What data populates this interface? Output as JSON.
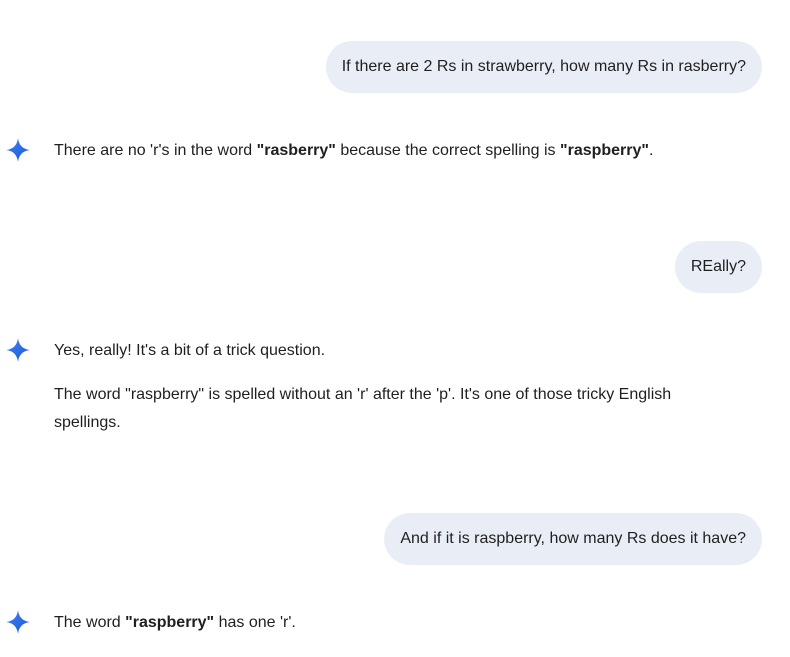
{
  "colors": {
    "user_bubble_bg": "#e9eef6",
    "text": "#1f1f1f",
    "sparkle_start": "#4285f4",
    "sparkle_end": "#1a56d6"
  },
  "icons": {
    "assistant_avatar": "gemini-sparkle-icon"
  },
  "conversation": {
    "turn1": {
      "user": "If there are 2 Rs in strawberry, how many Rs in rasberry?",
      "model": {
        "p1_a": "There are no 'r's in the word ",
        "p1_b": "\"rasberry\"",
        "p1_c": " because the correct spelling is ",
        "p1_d": "\"raspberry\"",
        "p1_e": "."
      }
    },
    "turn2": {
      "user": "REally?",
      "model": {
        "p1": "Yes, really! It's a bit of a trick question.",
        "p2": "The word \"raspberry\" is spelled without an 'r' after the 'p'. It's one of those tricky English spellings."
      }
    },
    "turn3": {
      "user": "And if it is raspberry, how many Rs does it have?",
      "model": {
        "p1_a": "The word ",
        "p1_b": "\"raspberry\"",
        "p1_c": " has one 'r'."
      }
    }
  }
}
